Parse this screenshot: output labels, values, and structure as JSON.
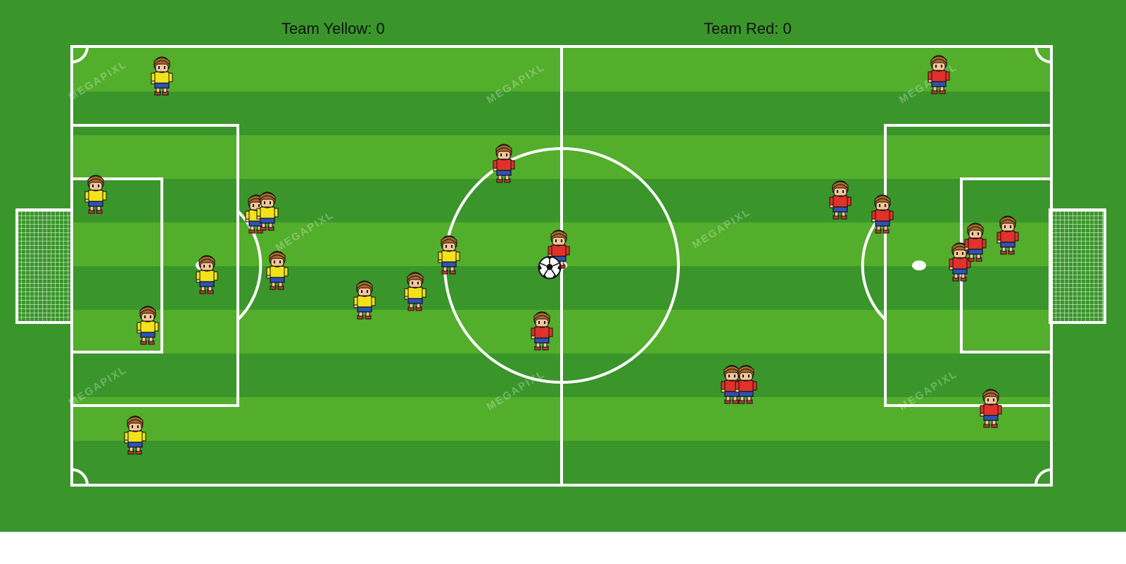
{
  "scoreboard": {
    "yellow_label": "Team Yellow: 0",
    "red_label": "Team Red: 0"
  },
  "watermark": "MEGAPIXL",
  "colors": {
    "grass_dark": "#3a962b",
    "grass_light": "#53ae2b",
    "lines": "#ffffff",
    "team_yellow_shirt": "#f2e21a",
    "team_red_shirt": "#e0322a",
    "shorts": "#2d53b8",
    "hair": "#a9682a",
    "skin": "#f6c59a"
  },
  "icons": {
    "ball": "soccer-ball-icon",
    "goal": "goal-net-icon",
    "player": "player-sprite-icon"
  },
  "teams": {
    "yellow": {
      "name": "Team Yellow",
      "score": 0,
      "player_count": 11
    },
    "red": {
      "name": "Team Red",
      "score": 0,
      "player_count": 11
    }
  }
}
